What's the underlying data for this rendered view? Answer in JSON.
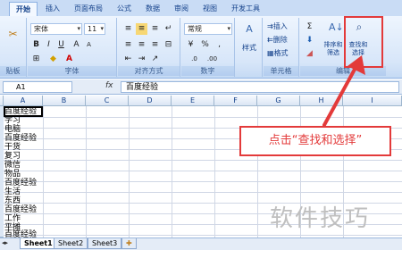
{
  "tabs": [
    "开始",
    "插入",
    "页面布局",
    "公式",
    "数据",
    "审阅",
    "视图",
    "开发工具"
  ],
  "font": {
    "name": "宋体",
    "size": "11"
  },
  "number_format": "常规",
  "groups": {
    "font": "字体",
    "align": "对齐方式",
    "number": "数字",
    "cells": "单元格",
    "edit": "编辑",
    "clip": "贴板"
  },
  "cells_buttons": {
    "insert": "插入",
    "delete": "删除",
    "format": "格式"
  },
  "styles_label": "样式",
  "sort_filter": "排序和筛选",
  "find_select": "查找和选择",
  "namebox": "A1",
  "fx": "fx",
  "formula": "百度经验",
  "columns": [
    "A",
    "B",
    "C",
    "D",
    "E",
    "F",
    "G",
    "H",
    "I"
  ],
  "cells": [
    "百度经验",
    "学习",
    "电脑",
    "百度经验",
    "干货",
    "复习",
    "微信",
    "物品",
    "百度经验",
    "生活",
    "东西",
    "百度经验",
    "工作",
    "平摊",
    "百度经验"
  ],
  "sheets": [
    "Sheet1",
    "Sheet2",
    "Sheet3"
  ],
  "callout": "点击“查找和选择”",
  "watermark": "软件技巧",
  "accent": "#e33a3a"
}
